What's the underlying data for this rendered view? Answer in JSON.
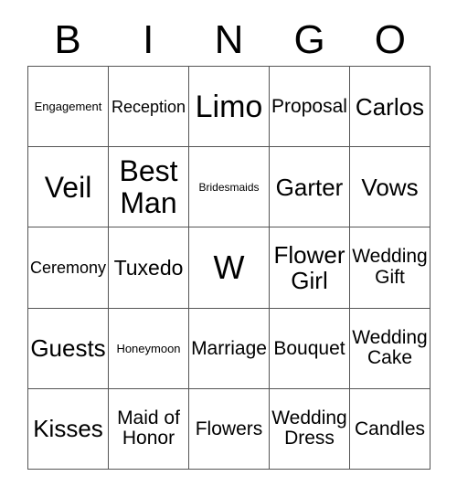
{
  "card": {
    "title": "BINGO",
    "header_letters": [
      "B",
      "I",
      "N",
      "G",
      "O"
    ],
    "grid_size": "5x5",
    "free_space": "W",
    "colors": {
      "text": "#000000",
      "grid_line": "#555555",
      "cell_background": "#ffffff",
      "page_background": "#ffffff"
    },
    "rows": [
      [
        {
          "label": "Engagement",
          "size": "sm"
        },
        {
          "label": "Reception",
          "size": "md"
        },
        {
          "label": "Limo",
          "size": "4xl"
        },
        {
          "label": "Proposal",
          "size": "lg"
        },
        {
          "label": "Carlos",
          "size": "2xl"
        }
      ],
      [
        {
          "label": "Veil",
          "size": "3xl"
        },
        {
          "label": "Best Man",
          "size": "3xl"
        },
        {
          "label": "Bridesmaids",
          "size": "xs"
        },
        {
          "label": "Garter",
          "size": "2xl"
        },
        {
          "label": "Vows",
          "size": "2xl"
        }
      ],
      [
        {
          "label": "Ceremony",
          "size": "md"
        },
        {
          "label": "Tuxedo",
          "size": "xl"
        },
        {
          "label": "W",
          "size": "free"
        },
        {
          "label": "Flower Girl",
          "size": "2xl"
        },
        {
          "label": "Wedding Gift",
          "size": "lg"
        }
      ],
      [
        {
          "label": "Guests",
          "size": "2xl"
        },
        {
          "label": "Honeymoon",
          "size": "sm"
        },
        {
          "label": "Marriage",
          "size": "lg"
        },
        {
          "label": "Bouquet",
          "size": "lg"
        },
        {
          "label": "Wedding Cake",
          "size": "lg"
        }
      ],
      [
        {
          "label": "Kisses",
          "size": "2xl"
        },
        {
          "label": "Maid of Honor",
          "size": "lg"
        },
        {
          "label": "Flowers",
          "size": "lg"
        },
        {
          "label": "Wedding Dress",
          "size": "lg"
        },
        {
          "label": "Candles",
          "size": "lg"
        }
      ]
    ]
  }
}
